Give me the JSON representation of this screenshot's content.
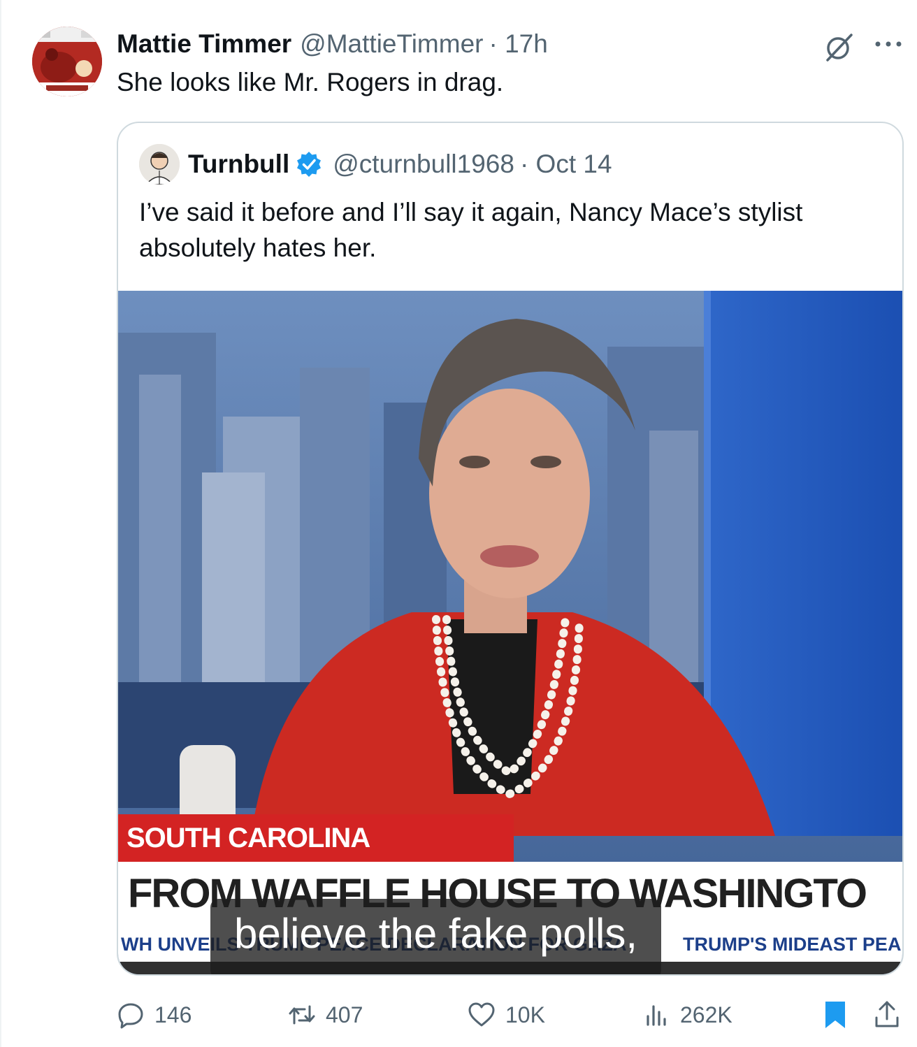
{
  "tweet": {
    "author_name": "Mattie Timmer",
    "author_handle": "@MattieTimmer",
    "time": "· 17h",
    "text": "She looks like Mr. Rogers in drag."
  },
  "quoted_tweet": {
    "author_name": "Turnbull",
    "author_handle": "@cturnbull1968",
    "date": "· Oct 14",
    "text": "I’ve said it before and I’ll say it again, Nancy Mace’s stylist absolutely hates her.",
    "media": {
      "spotlight_label": "SOUTH CAROLINA SPOTLIGHT",
      "headline": "FROM WAFFLE HOUSE TO WASHINGTO",
      "ticker_left": "WH UNVEILS TRUMP PEACE DECLARATION FOR GAZA",
      "ticker_right": "TRUMP'S MIDEAST PEA",
      "caption": "believe the fake polls,"
    }
  },
  "actions": {
    "replies": "146",
    "reposts": "407",
    "likes": "10K",
    "views": "262K"
  },
  "colors": {
    "text": "#0f1419",
    "secondary": "#536471",
    "verified": "#1d9bf0",
    "bookmark": "#1d9bf0",
    "cnn_red": "#d32323"
  },
  "icons": [
    "grok-icon",
    "more-icon",
    "verified-badge-icon",
    "reply-icon",
    "repost-icon",
    "like-icon",
    "views-icon",
    "bookmark-icon",
    "share-icon"
  ]
}
